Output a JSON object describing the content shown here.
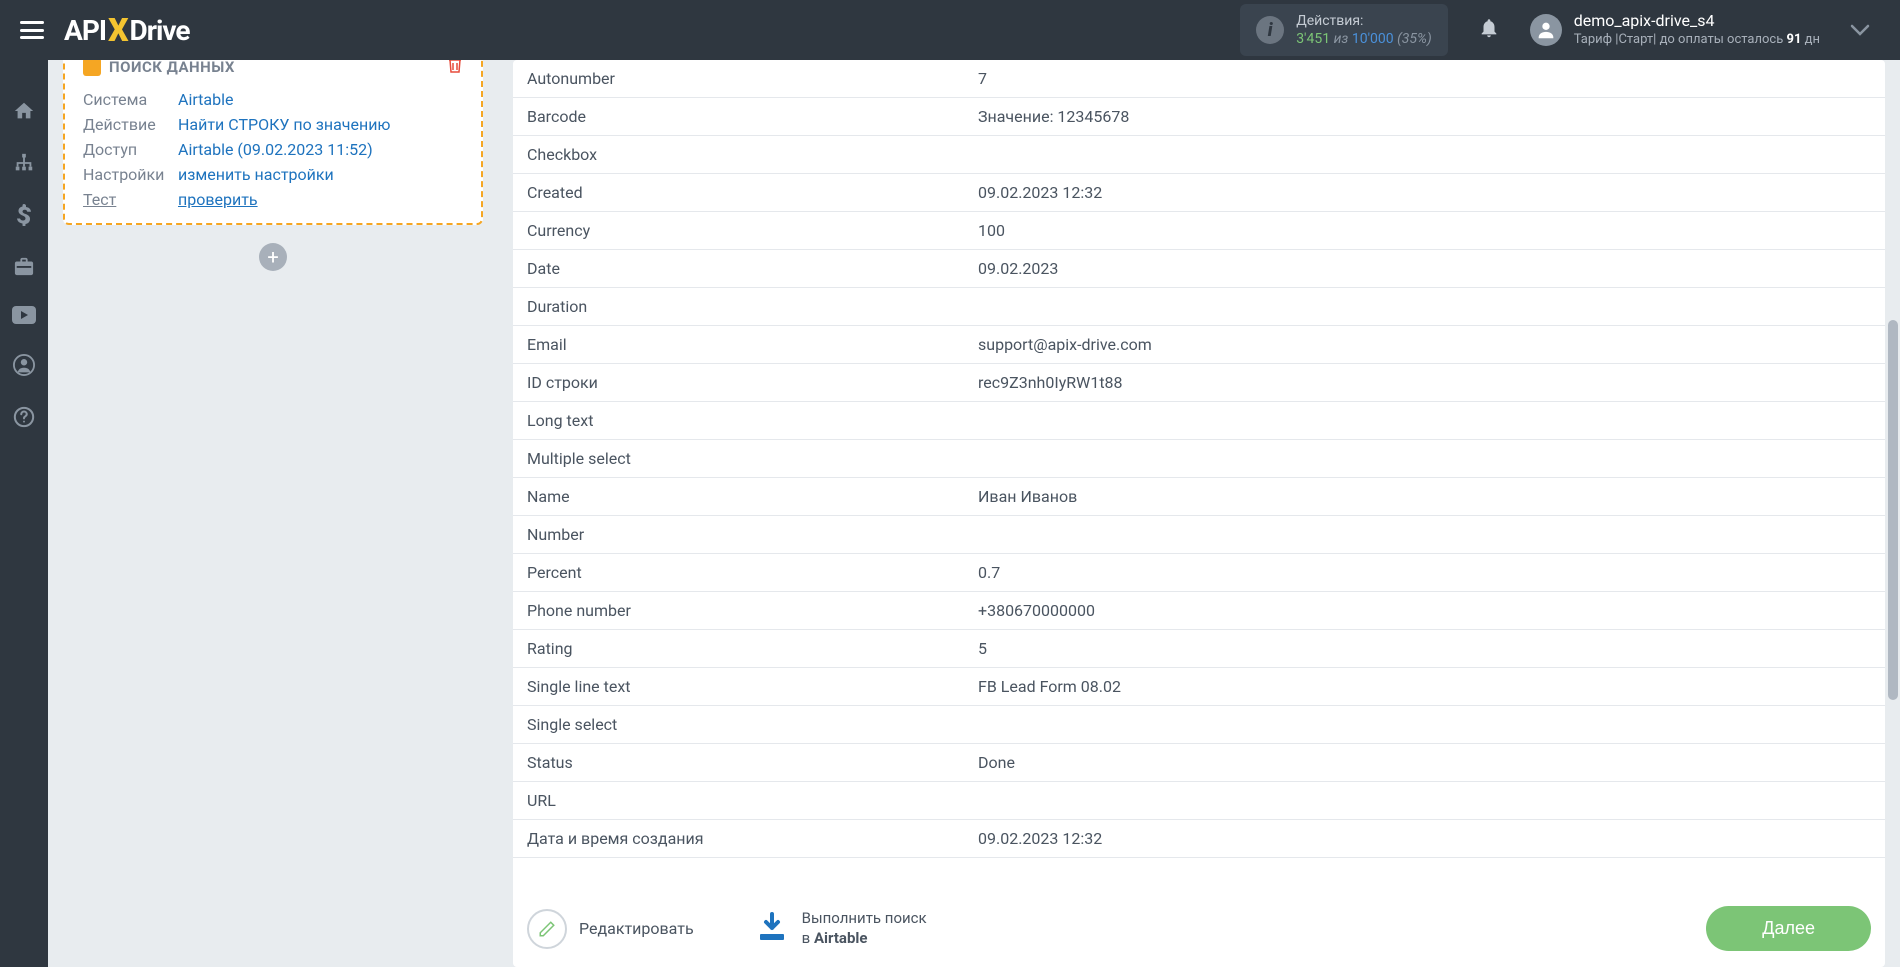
{
  "header": {
    "actions_label": "Действия:",
    "actions_count": "3'451",
    "actions_of": "из",
    "actions_total": "10'000",
    "actions_pct": "(35%)",
    "user_name": "demo_apix-drive_s4",
    "tariff_prefix": "Тариф |Старт| до оплаты осталось ",
    "tariff_days": "91",
    "tariff_suffix": " дн"
  },
  "card": {
    "title": "ПОИСК ДАННЫХ",
    "rows": {
      "system_label": "Система",
      "system_value": "Airtable",
      "action_label": "Действие",
      "action_value": "Найти СТРОКУ по значению",
      "access_label": "Доступ",
      "access_value": "Airtable (09.02.2023 11:52)",
      "settings_label": "Настройки",
      "settings_value": "изменить настройки",
      "test_label": "Тест",
      "test_value": "проверить"
    }
  },
  "data_rows": [
    {
      "key": "Autonumber",
      "val": "7"
    },
    {
      "key": "Barcode",
      "val": "Значение: 12345678"
    },
    {
      "key": "Checkbox",
      "val": ""
    },
    {
      "key": "Created",
      "val": "09.02.2023 12:32"
    },
    {
      "key": "Currency",
      "val": "100"
    },
    {
      "key": "Date",
      "val": "09.02.2023"
    },
    {
      "key": "Duration",
      "val": ""
    },
    {
      "key": "Email",
      "val": "support@apix-drive.com"
    },
    {
      "key": "ID строки",
      "val": "rec9Z3nh0IyRW1t88"
    },
    {
      "key": "Long text",
      "val": ""
    },
    {
      "key": "Multiple select",
      "val": ""
    },
    {
      "key": "Name",
      "val": "Иван Иванов"
    },
    {
      "key": "Number",
      "val": ""
    },
    {
      "key": "Percent",
      "val": "0.7"
    },
    {
      "key": "Phone number",
      "val": "+380670000000"
    },
    {
      "key": "Rating",
      "val": "5"
    },
    {
      "key": "Single line text",
      "val": "FB Lead Form 08.02"
    },
    {
      "key": "Single select",
      "val": ""
    },
    {
      "key": "Status",
      "val": "Done"
    },
    {
      "key": "URL",
      "val": ""
    },
    {
      "key": "Дата и время создания",
      "val": "09.02.2023 12:32"
    }
  ],
  "footer": {
    "edit": "Редактировать",
    "reload_line1": "Выполнить поиск",
    "reload_line2_prefix": "в ",
    "reload_line2_bold": "Airtable",
    "next": "Далее"
  }
}
